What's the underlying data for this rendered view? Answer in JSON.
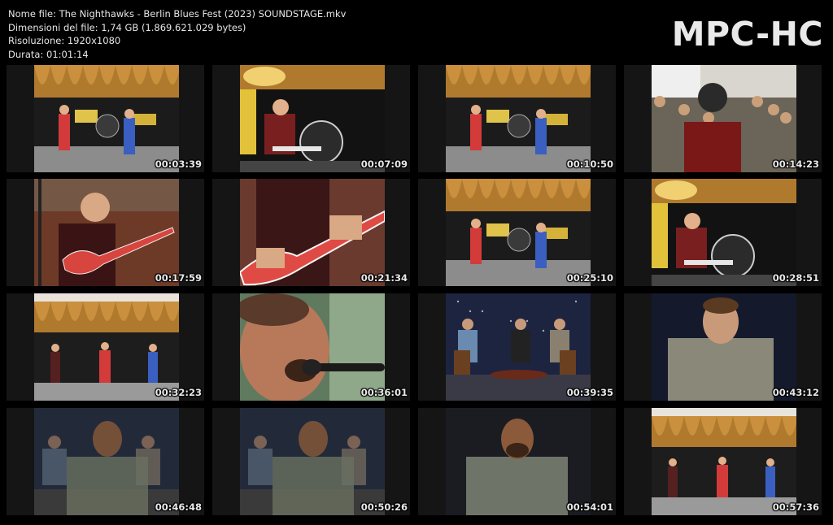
{
  "info": {
    "file_name": "Nome file: The Nighthawks - Berlin Blues Fest (2023) SOUNDSTAGE.mkv",
    "file_size": "Dimensioni del file: 1,74 GB (1.869.621.029 bytes)",
    "resolution": "Risoluzione: 1920x1080",
    "duration": "Durata: 01:01:14"
  },
  "brand": "MPC-HC",
  "thumbnails": [
    {
      "time": "00:03:39",
      "scene": "stage"
    },
    {
      "time": "00:07:09",
      "scene": "drums"
    },
    {
      "time": "00:10:50",
      "scene": "stage"
    },
    {
      "time": "00:14:23",
      "scene": "crowd"
    },
    {
      "time": "00:17:59",
      "scene": "guitar"
    },
    {
      "time": "00:21:34",
      "scene": "guitar-close"
    },
    {
      "time": "00:25:10",
      "scene": "stage"
    },
    {
      "time": "00:28:51",
      "scene": "drums"
    },
    {
      "time": "00:32:23",
      "scene": "stage-wide"
    },
    {
      "time": "00:36:01",
      "scene": "singer"
    },
    {
      "time": "00:39:35",
      "scene": "interview"
    },
    {
      "time": "00:43:12",
      "scene": "interview-single"
    },
    {
      "time": "00:46:48",
      "scene": "interview-blend"
    },
    {
      "time": "00:50:26",
      "scene": "interview-blend"
    },
    {
      "time": "00:54:01",
      "scene": "interview-single-dark"
    },
    {
      "time": "00:57:36",
      "scene": "stage-wide"
    }
  ]
}
